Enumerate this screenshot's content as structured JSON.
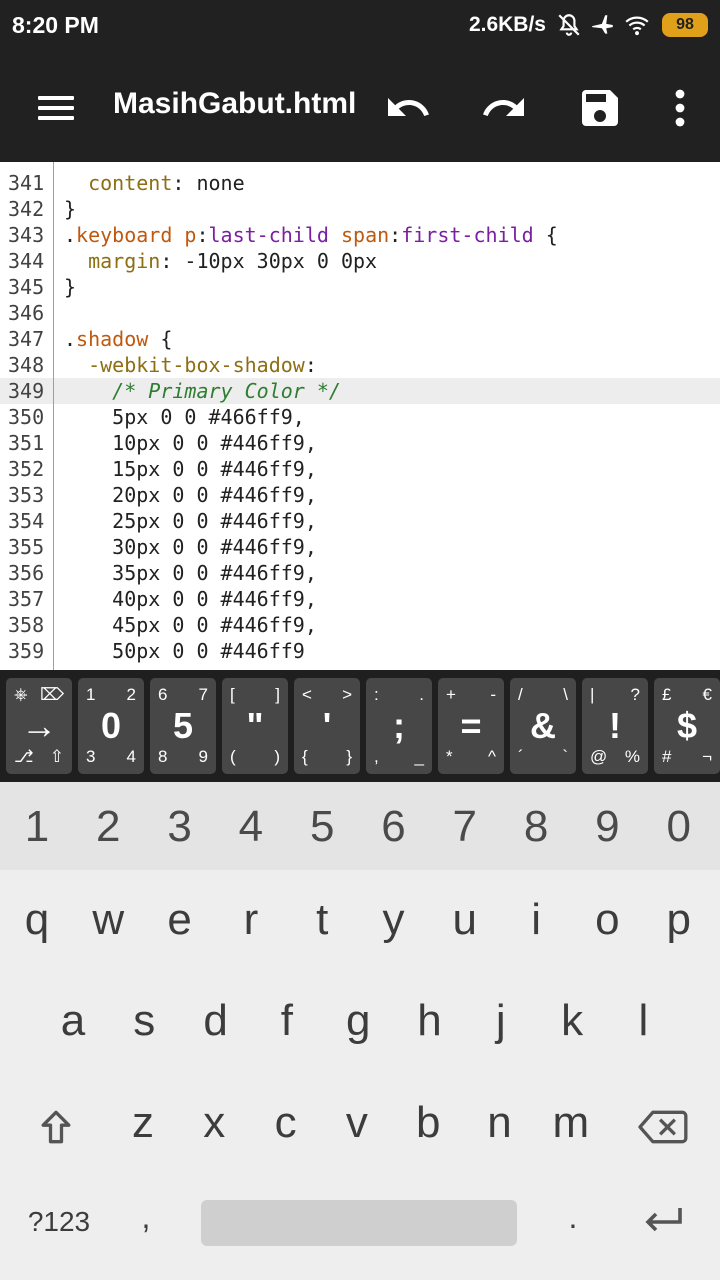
{
  "status_bar": {
    "time": "8:20 PM",
    "network_speed": "2.6KB/s",
    "battery_level": "98",
    "icons": [
      "bell-off-icon",
      "airplane-icon",
      "wifi-icon",
      "battery-icon"
    ]
  },
  "app_bar": {
    "file_name": "MasihGabut.html",
    "icons": [
      "menu-icon",
      "undo-icon",
      "redo-icon",
      "save-icon",
      "more-vert-icon"
    ]
  },
  "editor": {
    "highlighted_line": "349",
    "lines": [
      {
        "num": "341",
        "indent": "  ",
        "tokens": [
          {
            "t": "content",
            "c": "prop"
          },
          {
            "t": ": none",
            "c": ""
          }
        ]
      },
      {
        "num": "342",
        "indent": "",
        "tokens": [
          {
            "t": "}",
            "c": ""
          }
        ]
      },
      {
        "num": "343",
        "indent": "",
        "tokens": [
          {
            "t": ".",
            "c": ""
          },
          {
            "t": "keyboard",
            "c": "sel"
          },
          {
            "t": " ",
            "c": ""
          },
          {
            "t": "p",
            "c": "sel"
          },
          {
            "t": ":",
            "c": ""
          },
          {
            "t": "last-child",
            "c": "kw"
          },
          {
            "t": " ",
            "c": ""
          },
          {
            "t": "span",
            "c": "sel"
          },
          {
            "t": ":",
            "c": ""
          },
          {
            "t": "first-child",
            "c": "kw"
          },
          {
            "t": " {",
            "c": ""
          }
        ]
      },
      {
        "num": "344",
        "indent": "  ",
        "tokens": [
          {
            "t": "margin",
            "c": "prop"
          },
          {
            "t": ": -10px 30px 0 0px",
            "c": ""
          }
        ]
      },
      {
        "num": "345",
        "indent": "",
        "tokens": [
          {
            "t": "}",
            "c": ""
          }
        ]
      },
      {
        "num": "346",
        "indent": "",
        "tokens": []
      },
      {
        "num": "347",
        "indent": "",
        "tokens": [
          {
            "t": ".",
            "c": ""
          },
          {
            "t": "shadow",
            "c": "sel"
          },
          {
            "t": " {",
            "c": ""
          }
        ]
      },
      {
        "num": "348",
        "indent": "  ",
        "tokens": [
          {
            "t": "-webkit-box-shadow",
            "c": "prop"
          },
          {
            "t": ":",
            "c": ""
          }
        ]
      },
      {
        "num": "349",
        "indent": "    ",
        "tokens": [
          {
            "t": "/* Primary Color */",
            "c": "cmt"
          }
        ]
      },
      {
        "num": "350",
        "indent": "    ",
        "tokens": [
          {
            "t": "5px 0 0 #466ff9,",
            "c": ""
          }
        ]
      },
      {
        "num": "351",
        "indent": "    ",
        "tokens": [
          {
            "t": "10px 0 0 #446ff9,",
            "c": ""
          }
        ]
      },
      {
        "num": "352",
        "indent": "    ",
        "tokens": [
          {
            "t": "15px 0 0 #446ff9,",
            "c": ""
          }
        ]
      },
      {
        "num": "353",
        "indent": "    ",
        "tokens": [
          {
            "t": "20px 0 0 #446ff9,",
            "c": ""
          }
        ]
      },
      {
        "num": "354",
        "indent": "    ",
        "tokens": [
          {
            "t": "25px 0 0 #446ff9,",
            "c": ""
          }
        ]
      },
      {
        "num": "355",
        "indent": "    ",
        "tokens": [
          {
            "t": "30px 0 0 #446ff9,",
            "c": ""
          }
        ]
      },
      {
        "num": "356",
        "indent": "    ",
        "tokens": [
          {
            "t": "35px 0 0 #446ff9,",
            "c": ""
          }
        ]
      },
      {
        "num": "357",
        "indent": "    ",
        "tokens": [
          {
            "t": "40px 0 0 #446ff9,",
            "c": ""
          }
        ]
      },
      {
        "num": "358",
        "indent": "    ",
        "tokens": [
          {
            "t": "45px 0 0 #446ff9,",
            "c": ""
          }
        ]
      },
      {
        "num": "359",
        "indent": "    ",
        "tokens": [
          {
            "t": "50px 0 0 #446ff9",
            "c": ""
          }
        ]
      }
    ]
  },
  "extra_keys": [
    {
      "center": "→",
      "tl": "⎈",
      "tr": "⌦",
      "bl": "⎇",
      "br": "⇧"
    },
    {
      "center": "0",
      "tl": "1",
      "tr": "2",
      "bl": "3",
      "br": "4"
    },
    {
      "center": "5",
      "tl": "6",
      "tr": "7",
      "bl": "8",
      "br": "9"
    },
    {
      "center": "\"",
      "tl": "[",
      "tr": "]",
      "bl": "(",
      "br": ")"
    },
    {
      "center": "'",
      "tl": "<",
      "tr": ">",
      "bl": "{",
      "br": "}"
    },
    {
      "center": ";",
      "tl": ":",
      "tr": ".",
      "bl": ",",
      "br": "_"
    },
    {
      "center": "=",
      "tl": "+",
      "tr": "-",
      "bl": "*",
      "br": "^"
    },
    {
      "center": "&",
      "tl": "/",
      "tr": "\\",
      "bl": "´",
      "br": "`"
    },
    {
      "center": "!",
      "tl": "|",
      "tr": "?",
      "bl": "@",
      "br": "%"
    },
    {
      "center": "$",
      "tl": "£",
      "tr": "€",
      "bl": "#",
      "br": "¬"
    }
  ],
  "keyboard": {
    "number_row": [
      "1",
      "2",
      "3",
      "4",
      "5",
      "6",
      "7",
      "8",
      "9",
      "0"
    ],
    "row1": [
      "q",
      "w",
      "e",
      "r",
      "t",
      "y",
      "u",
      "i",
      "o",
      "p"
    ],
    "row2": [
      "a",
      "s",
      "d",
      "f",
      "g",
      "h",
      "j",
      "k",
      "l"
    ],
    "row3": [
      "z",
      "x",
      "c",
      "v",
      "b",
      "n",
      "m"
    ],
    "symbols_key": "?123",
    "comma": ",",
    "period": ".",
    "icons": [
      "shift-icon",
      "backspace-icon",
      "enter-icon"
    ]
  },
  "colors": {
    "appbar_bg": "#212121",
    "selector": "#c0580e",
    "pseudo_class": "#7b1fa2",
    "property": "#8d6e12",
    "comment": "#2e7d32",
    "highlight_line": "#ededed",
    "extra_key_bg": "#474747"
  }
}
